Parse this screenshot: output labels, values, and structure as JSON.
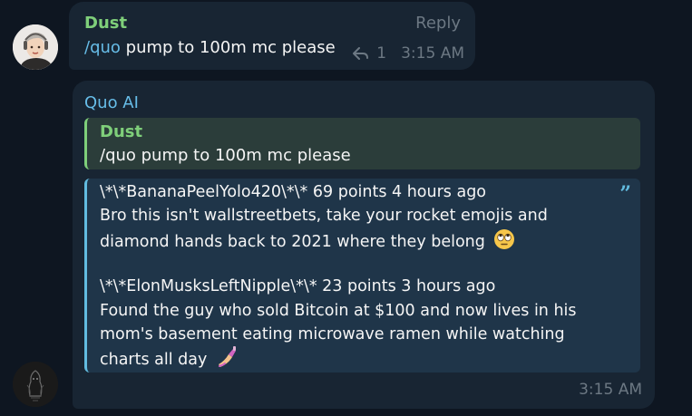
{
  "messages": [
    {
      "sender": "Dust",
      "reply_label": "Reply",
      "command": "/quo",
      "text": " pump to 100m mc please",
      "reply_count": "1",
      "time": "3:15 AM",
      "sender_color": "#7fcf7a"
    },
    {
      "sender": "Quo AI",
      "sender_color": "#67bde8",
      "quoted": {
        "sender": "Dust",
        "text": "/quo pump to 100m mc please"
      },
      "blockquote_lines": [
        "\\*\\*BananaPeelYolo420\\*\\* 69 points 4 hours ago",
        "Bro this isn't wallstreetbets, take your rocket emojis and",
        "diamond hands back to 2021 where they belong",
        "\\*\\*ElonMusksLeftNipple\\*\\* 23 points 3 hours ago",
        "Found the guy who sold Bitcoin at $100 and now lives in his",
        "mom's basement eating microwave ramen while watching",
        "charts all day"
      ],
      "emojis": [
        "rolling-eyes-emoji",
        "nail-polish-emoji"
      ],
      "time": "3:15 AM"
    }
  ],
  "icons": {
    "reply": "reply-arrow-icon",
    "quote": "quote-mark-icon"
  },
  "colors": {
    "background": "#0e1621",
    "bubble": "#182533",
    "accent": "#67bde8",
    "muted": "#6c7883"
  }
}
